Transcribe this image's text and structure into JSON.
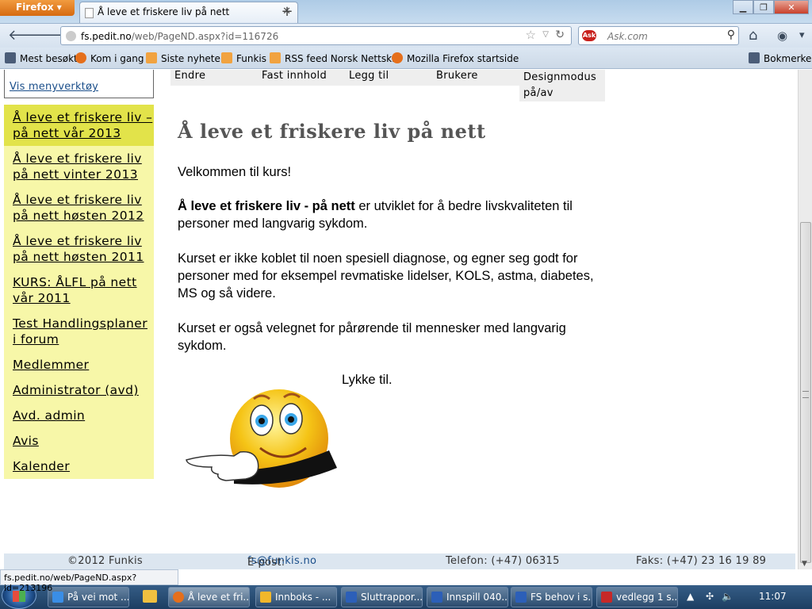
{
  "browser": {
    "app_button": "Firefox",
    "tab_title": "Å leve et friskere liv på nett",
    "url_domain": "fs.pedit.no",
    "url_path": "/web/PageND.aspx?id=116726",
    "search_placeholder": "Ask.com",
    "search_logo": "Ask",
    "win_min": "▁",
    "win_max": "❐",
    "win_close": "✕",
    "bookmarks": [
      {
        "label": "Mest besøkt",
        "icon": "bookmark-icon"
      },
      {
        "label": "Kom i gang",
        "icon": "firefox-icon"
      },
      {
        "label": "Siste nyheter",
        "icon": "rss-icon"
      },
      {
        "label": "Funkis",
        "icon": "folder-icon"
      },
      {
        "label": "RSS feed Norsk Nettsk...",
        "icon": "rss-icon"
      },
      {
        "label": "Mozilla Firefox startside",
        "icon": "firefox-icon"
      }
    ],
    "bookmarks_menu": "Bokmerker",
    "status_url": "fs.pedit.no/web/PageND.aspx?id=213196"
  },
  "page": {
    "menu_tool_link": "Vis menyverktøy",
    "sidebar": [
      "Å leve et friskere liv – på nett vår 2013",
      "Å leve et friskere liv på nett vinter 2013",
      "Å leve et friskere liv på nett høsten 2012",
      "Å leve et friskere liv på nett høsten 2011",
      "KURS: ÅLFL på nett vår 2011",
      "Test Handlingsplaner i forum",
      "Medlemmer",
      "Administrator (avd)",
      "Avd. admin",
      "Avis",
      "Kalender"
    ],
    "toolbar": [
      "Endre",
      "Fast innhold",
      "Legg til",
      "Brukere",
      "Designmodus på/av"
    ],
    "title": "Å leve et friskere liv på nett",
    "welcome": "Velkommen til kurs!",
    "para1_bold": "Å leve et friskere liv - på nett",
    "para1_rest": " er utviklet for å bedre livskvaliteten til personer med langvarig sykdom.",
    "para2": "Kurset er ikke koblet til noen spesiell diagnose, og egner seg godt for personer med for eksempel revmatiske lidelser, KOLS, astma, diabetes, MS og så videre.",
    "para3": "Kurset er også velegnet for pårørende til mennesker med langvarig sykdom.",
    "good_luck": "Lykke til.",
    "footer": {
      "copyright": "©2012 Funkis",
      "email_label": "E-post: ",
      "email": "fs@funkis.no",
      "phone": "Telefon: (+47) 06315",
      "fax": "Faks: (+47) 23 16 19 89"
    }
  },
  "taskbar": {
    "items": [
      {
        "label": "På vei mot ...",
        "icon": "ie-icon"
      },
      {
        "label": "Å leve et fri...",
        "icon": "firefox-icon"
      },
      {
        "label": "Innboks - ...",
        "icon": "outlook-icon"
      },
      {
        "label": "Sluttrappor...",
        "icon": "word-icon"
      },
      {
        "label": "Innspill 040...",
        "icon": "word-icon"
      },
      {
        "label": "FS behov i s...",
        "icon": "word-icon"
      },
      {
        "label": "vedlegg 1 s...",
        "icon": "pdf-icon"
      }
    ],
    "clock": "11:07"
  },
  "colors": {
    "sidebar_bg": "#f7f7a8",
    "sidebar_active": "#e2e34a",
    "link": "#1a4e8a",
    "footer_bg": "#dce6f0"
  }
}
